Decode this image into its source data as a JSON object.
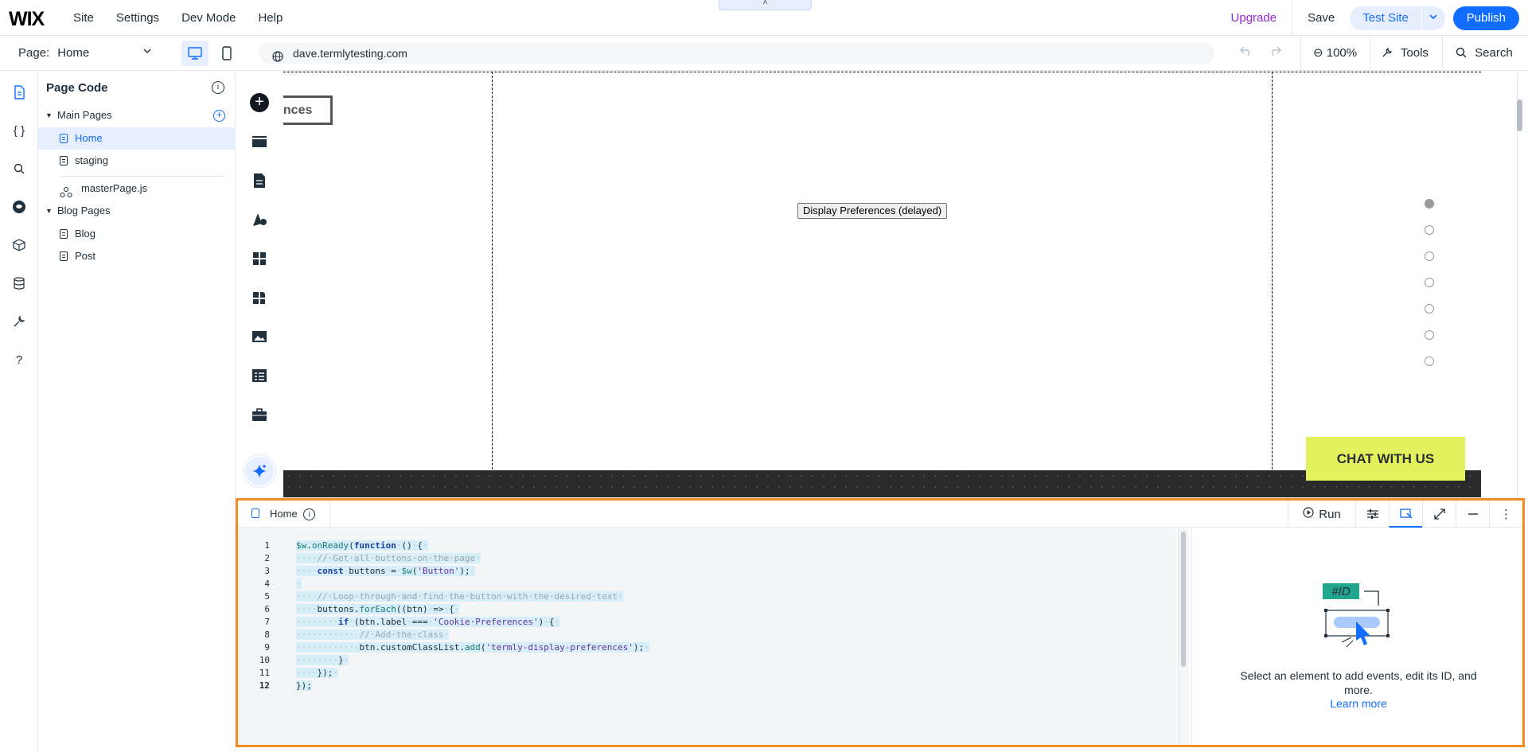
{
  "topbar": {
    "logo": "WIX",
    "menu": [
      "Site",
      "Settings",
      "Dev Mode",
      "Help"
    ],
    "collapse_glyph": "˄",
    "upgrade": "Upgrade",
    "save": "Save",
    "test_site": "Test Site",
    "publish": "Publish"
  },
  "secbar": {
    "page_label": "Page:",
    "page_name": "Home",
    "url": "dave.termlytesting.com",
    "zoom": "100%",
    "tools": "Tools",
    "search": "Search"
  },
  "page_code": {
    "title": "Page Code",
    "sections": [
      {
        "label": "Main Pages",
        "items": [
          "Home",
          "staging"
        ]
      },
      {
        "label": "Blog Pages",
        "items": [
          "Blog",
          "Post"
        ]
      }
    ],
    "master": "masterPage.js"
  },
  "canvas": {
    "preferences_fragment": "ences",
    "display_button": "Display Preferences (delayed)",
    "chat_button": "CHAT WITH US"
  },
  "code_panel": {
    "tab": "Home",
    "run": "Run",
    "empty_text": "Select an element to add events, edit its ID, and more.",
    "learn_more": "Learn more",
    "id_badge": "#ID",
    "line_numbers": [
      "1",
      "2",
      "3",
      "4",
      "5",
      "6",
      "7",
      "8",
      "9",
      "10",
      "11",
      "12"
    ]
  },
  "colors": {
    "accent": "#116dff",
    "upgrade": "#9a27d5",
    "highlight_border": "#f28d22",
    "chat_bg": "#e3f25c",
    "badge": "#21a68d"
  }
}
